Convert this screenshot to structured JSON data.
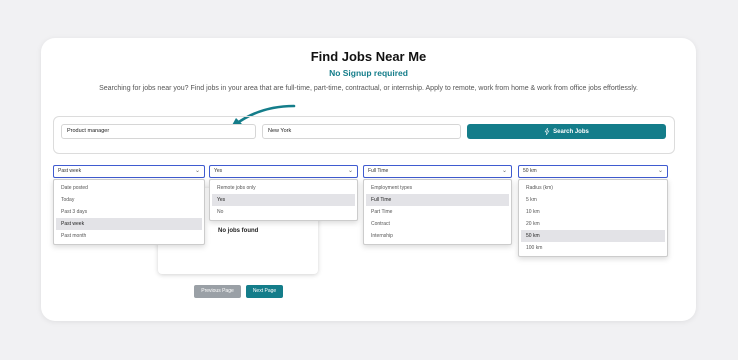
{
  "header": {
    "title": "Find Jobs Near Me",
    "subtitle": "No Signup required",
    "description": "Searching for jobs near you? Find jobs in your area that are full-time, part-time, contractual, or internship. Apply to remote, work from home & work from office jobs effortlessly."
  },
  "search": {
    "job_value": "Product manager",
    "location_value": "New York",
    "button_label": "Search Jobs",
    "button_icon": "lightning-icon"
  },
  "filters": {
    "date_posted": {
      "value": "Past week",
      "options": [
        "Date posted",
        "Today",
        "Past 3 days",
        "Past week",
        "Past month"
      ]
    },
    "remote": {
      "value": "Yes",
      "options": [
        "Remote jobs only",
        "Yes",
        "No"
      ]
    },
    "employment": {
      "value": "Full Time",
      "options": [
        "Employment types",
        "Full Time",
        "Part Time",
        "Contract",
        "Internship"
      ]
    },
    "radius": {
      "value": "50 km",
      "options": [
        "Radius (km)",
        "5 km",
        "10 km",
        "20 km",
        "50 km",
        "100 km"
      ]
    }
  },
  "results": {
    "empty_text": "No jobs found"
  },
  "pagination": {
    "prev_label": "Previous Page",
    "next_label": "Next Page"
  },
  "colors": {
    "accent": "#147d8a",
    "select_border": "#3f5bd0",
    "prev_button": "#9aa0a6"
  }
}
